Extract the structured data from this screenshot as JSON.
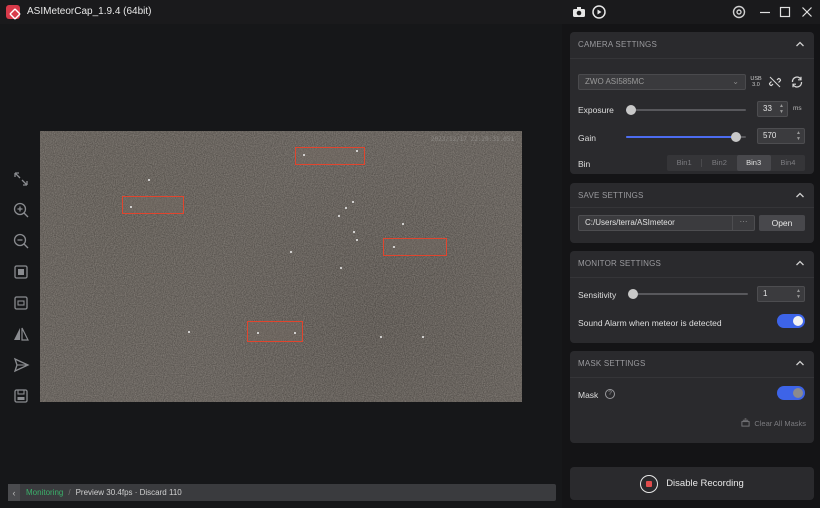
{
  "window": {
    "title": "ASIMeteorCap_1.9.4 (64bit)"
  },
  "titlebar_icons": [
    "camera-icon",
    "record-playback-icon",
    "settings-icon",
    "minimize-icon",
    "maximize-icon",
    "close-icon"
  ],
  "toolbar": {
    "tools": [
      "fit-screen-icon",
      "zoom-in-icon",
      "zoom-out-icon",
      "full-size-icon",
      "actual-size-icon",
      "flip-icon",
      "send-icon",
      "save-icon"
    ]
  },
  "preview": {
    "timestamp": "2023/12/17 22:29:31.051",
    "detection_count": 4
  },
  "status": {
    "mode": "Monitoring",
    "info": "Preview 30.4fps · Discard 110"
  },
  "camera_settings": {
    "header": "CAMERA SETTINGS",
    "camera_name": "ZWO ASI585MC",
    "usb_line1": "USB",
    "usb_line2": "3.0",
    "exposure_label": "Exposure",
    "exposure_value": "33",
    "exposure_unit": "ms",
    "exposure_level": 0.03,
    "gain_label": "Gain",
    "gain_value": "570",
    "gain_level": 0.92,
    "bin_label": "Bin",
    "bin_options": [
      "Bin1",
      "Bin2",
      "Bin3",
      "Bin4"
    ],
    "bin_selected": "Bin3"
  },
  "save_settings": {
    "header": "SAVE SETTINGS",
    "path": "C:/Users/terra/ASImeteor",
    "more": "···",
    "open_label": "Open"
  },
  "monitor_settings": {
    "header": "MONITOR SETTINGS",
    "sensitivity_label": "Sensitivity",
    "sensitivity_value": "1",
    "sensitivity_level": 0.0,
    "sound_alarm_label": "Sound Alarm when meteor is detected",
    "sound_alarm_on": true
  },
  "mask_settings": {
    "header": "MASK SETTINGS",
    "mask_label": "Mask",
    "help": "?",
    "mask_on": true,
    "clear_label": "Clear All Masks"
  },
  "record": {
    "label": "Disable Recording"
  },
  "colors": {
    "accent": "#4c6cf0",
    "detect_box": "#e0452e",
    "monitoring": "#3bb06a",
    "record_dot": "#e24c4c"
  }
}
